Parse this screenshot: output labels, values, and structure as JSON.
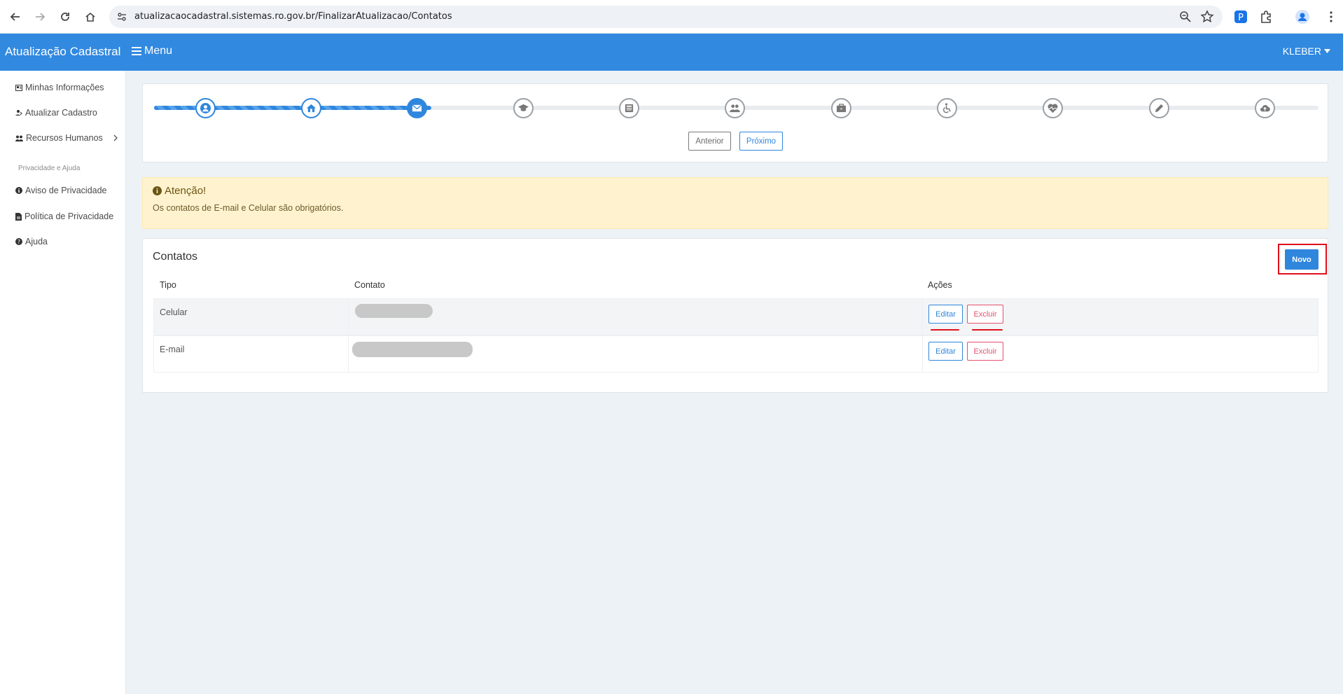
{
  "browser": {
    "url": "atualizacaocadastral.sistemas.ro.gov.br/FinalizarAtualizacao/Contatos"
  },
  "header": {
    "brand": "Atualização Cadastral",
    "menu_label": "Menu",
    "user_name": "KLEBER"
  },
  "sidebar": {
    "items": [
      {
        "label": "Minhas Informações",
        "icon": "id-card-icon"
      },
      {
        "label": "Atualizar Cadastro",
        "icon": "user-edit-icon"
      },
      {
        "label": "Recursos Humanos",
        "icon": "users-icon"
      }
    ],
    "section_title": "Privacidade e Ajuda",
    "privacy_items": [
      {
        "label": "Aviso de Privacidade",
        "icon": "info-circle-icon"
      },
      {
        "label": "Política de Privacidade",
        "icon": "file-icon"
      },
      {
        "label": "Ajuda",
        "icon": "question-circle-icon"
      }
    ]
  },
  "stepper": {
    "steps": [
      {
        "icon": "user-icon",
        "state": "done"
      },
      {
        "icon": "home-icon",
        "state": "done"
      },
      {
        "icon": "envelope-icon",
        "state": "current"
      },
      {
        "icon": "graduation-cap-icon",
        "state": "pending"
      },
      {
        "icon": "newspaper-icon",
        "state": "pending"
      },
      {
        "icon": "users-icon",
        "state": "pending"
      },
      {
        "icon": "briefcase-icon",
        "state": "pending"
      },
      {
        "icon": "wheelchair-icon",
        "state": "pending"
      },
      {
        "icon": "heartbeat-icon",
        "state": "pending"
      },
      {
        "icon": "pencil-icon",
        "state": "pending"
      },
      {
        "icon": "cloud-upload-icon",
        "state": "pending"
      }
    ],
    "prev_label": "Anterior",
    "next_label": "Próximo"
  },
  "alert": {
    "title": "Atenção!",
    "text": "Os contatos de E-mail e Celular são obrigatórios."
  },
  "contacts": {
    "title": "Contatos",
    "new_label": "Novo",
    "columns": [
      "Tipo",
      "Contato",
      "Ações"
    ],
    "rows": [
      {
        "tipo": "Celular",
        "edit_label": "Editar",
        "delete_label": "Excluir"
      },
      {
        "tipo": "E-mail",
        "edit_label": "Editar",
        "delete_label": "Excluir"
      }
    ]
  },
  "colors": {
    "primary": "#3189e0",
    "danger": "#e4506d",
    "warning_bg": "#fff3cf",
    "annotation_red": "#e0101b"
  }
}
